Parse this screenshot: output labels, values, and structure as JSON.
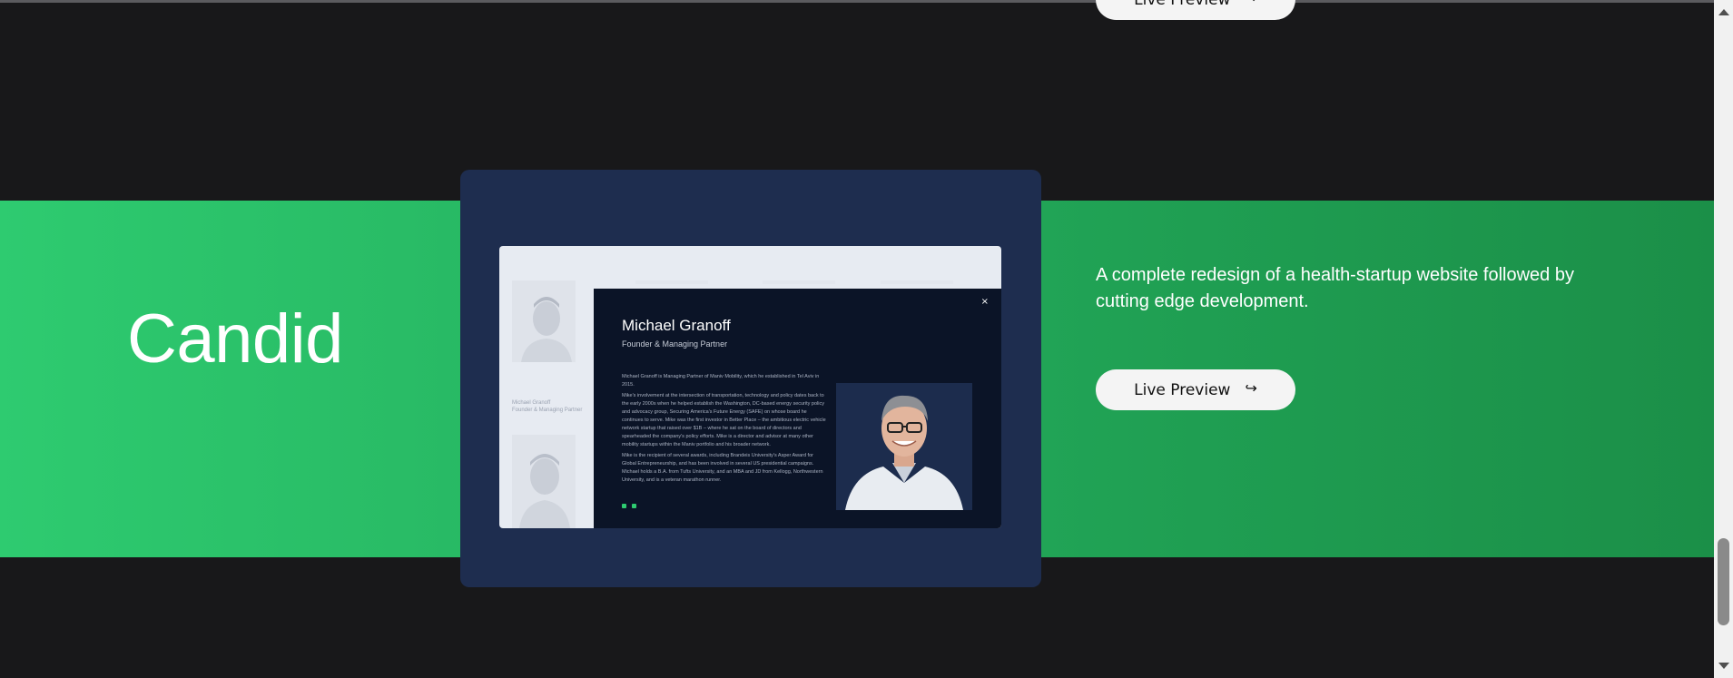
{
  "top_project": {
    "button_label": "Live Preview"
  },
  "project": {
    "title": "Candid",
    "description": "A complete redesign of a health-startup website followed by cutting edge development.",
    "button_label": "Live Preview",
    "band_color": "#22b35e",
    "card_color": "#1e2d4f"
  },
  "preview": {
    "background_cards": [
      {
        "name": "Michael Granoff",
        "role": "Founder & Managing Partner"
      }
    ],
    "modal": {
      "close_glyph": "×",
      "name": "Michael Granoff",
      "role": "Founder & Managing Partner",
      "bio": [
        "Michael Granoff is Managing Partner of Maniv Mobility, which he established in Tel Aviv in 2015.",
        "Mike's involvement at the intersection of transportation, technology and policy dates back to the early 2000s when he helped establish the Washington, DC-based energy security policy and advocacy group, Securing America's Future Energy (SAFE) on whose board he continues to serve. Mike was the first investor in Better Place – the ambitious electric vehicle network startup that raised over $1B – where he sat on the board of directors and spearheaded the company's policy efforts. Mike is a director and advisor at many other mobility startups within the Maniv portfolio and his broader network.",
        "Mike is the recipient of several awards, including Brandeis University's Asper Award for Global Entrepreneurship, and has been involved in several US presidential campaigns. Michael holds a B.A. from Tufts University, and an MBA and JD from Kellogg, Northwestern University, and is a veteran marathon runner."
      ],
      "social_icons": [
        "linkedin-icon",
        "twitter-icon"
      ]
    }
  },
  "arrow_glyph": "↪"
}
